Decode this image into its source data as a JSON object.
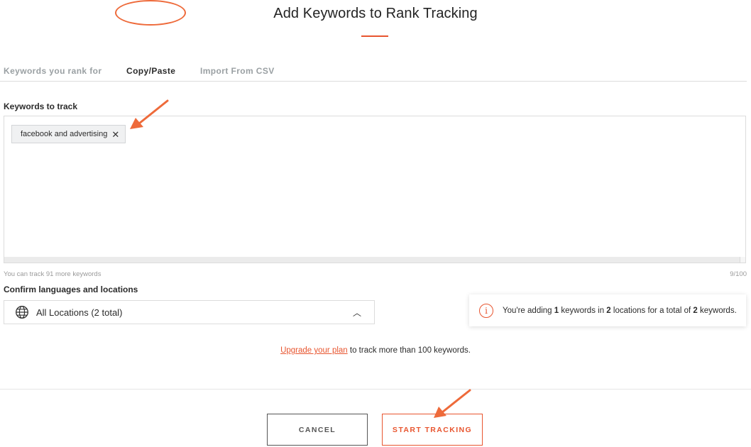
{
  "title": "Add Keywords to Rank Tracking",
  "tabs": [
    {
      "label": "Keywords you rank for",
      "active": false
    },
    {
      "label": "Copy/Paste",
      "active": true
    },
    {
      "label": "Import From CSV",
      "active": false
    }
  ],
  "keywords_label": "Keywords to track",
  "keywords": [
    {
      "text": "facebook and advertising"
    }
  ],
  "track_hint": "You can track 91 more keywords",
  "counter": "9/100",
  "locations_label": "Confirm languages and locations",
  "location_select": {
    "value": "All Locations (2 total)",
    "icon": "globe-icon",
    "chevron": "chevron-up-icon"
  },
  "info": {
    "icon": "info-icon",
    "part1": "You're adding ",
    "keywords_count": "1",
    "part2": " keywords in ",
    "locations_count": "2",
    "part3": " locations for a total of ",
    "total": "2",
    "part4": " keywords."
  },
  "upgrade": {
    "link": "Upgrade your plan",
    "text": " to track more than 100 keywords."
  },
  "buttons": {
    "cancel": "CANCEL",
    "start": "START TRACKING"
  },
  "colors": {
    "accent": "#e8552f",
    "annotation": "#ee6a3a"
  }
}
